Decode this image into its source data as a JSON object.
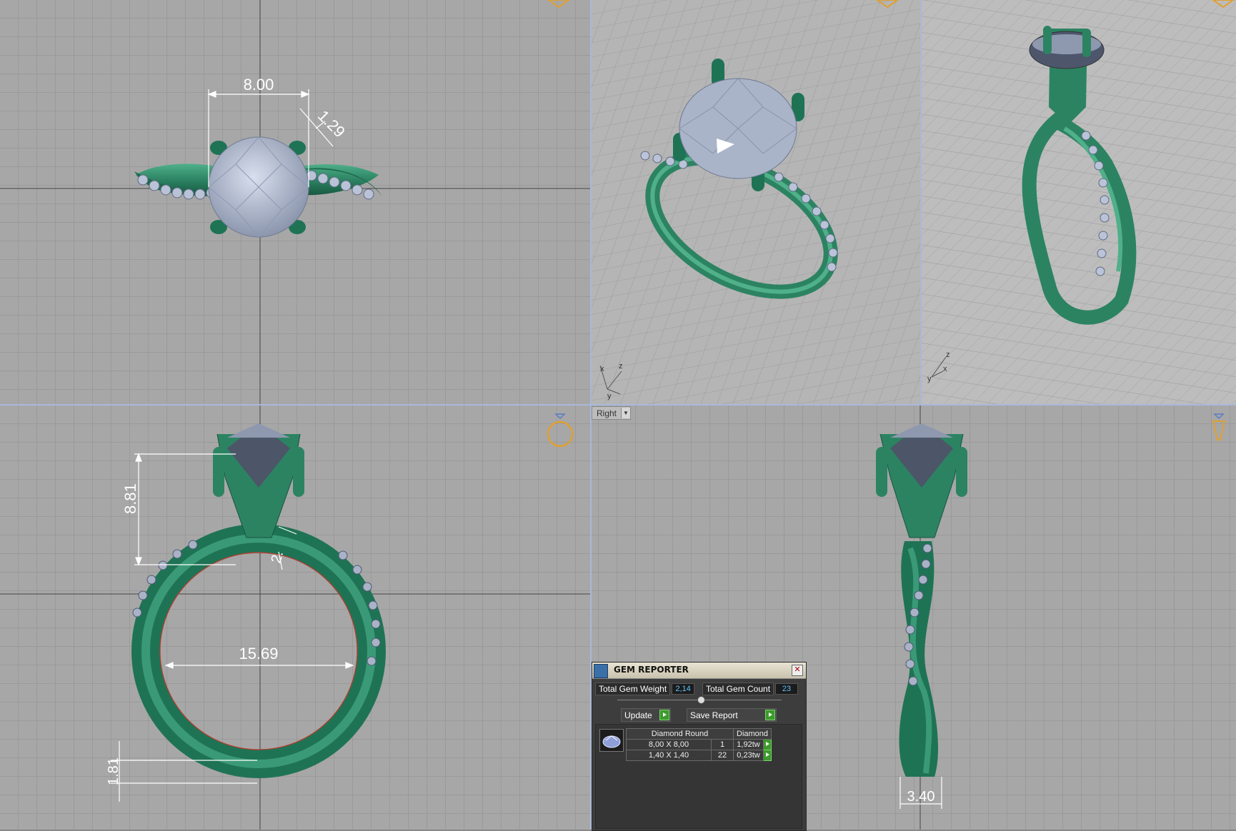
{
  "viewports": {
    "top": {
      "dimensions": [
        "8.00",
        "1.29"
      ]
    },
    "front": {
      "dimensions": [
        "8.81",
        "2.",
        "15.69",
        "1.81"
      ]
    },
    "right": {
      "label": "Right",
      "dimensions": [
        "3.40"
      ]
    },
    "persp_axes": {
      "x": "x",
      "y": "y",
      "z": "z"
    }
  },
  "gem_reporter": {
    "title": "GEM REPORTER",
    "total_weight_label": "Total Gem Weight",
    "total_weight_value": "2,14",
    "total_count_label": "Total Gem Count",
    "total_count_value": "23",
    "update_label": "Update",
    "save_report_label": "Save Report",
    "table_headers": [
      "Diamond Round",
      "Diamond"
    ],
    "rows": [
      {
        "size": "8,00 X 8,00",
        "count": "1",
        "weight": "1,92tw"
      },
      {
        "size": "1,40 X 1,40",
        "count": "22",
        "weight": "0,23tw"
      }
    ]
  },
  "colors": {
    "viewport_bg": "#a7a7a7",
    "grid_line": "#8c8c8c",
    "metal": "#2f8a6a",
    "gem": "#b4bdd0",
    "accent_axis": "#e0a030",
    "divider": "#a9b9d9"
  }
}
